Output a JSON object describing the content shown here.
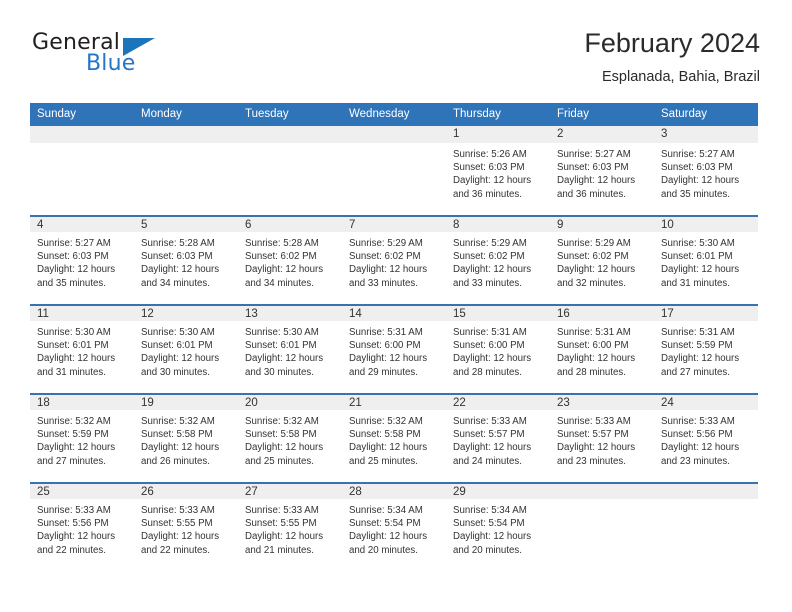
{
  "brand": {
    "name_part1": "General",
    "name_part2": "Blue",
    "logo_icon": "triangle-logo-icon"
  },
  "header": {
    "title": "February 2024",
    "location": "Esplanada, Bahia, Brazil"
  },
  "colors": {
    "header_blue": "#2f73b8",
    "week_divider_blue": "#3a72b0",
    "daynum_band_gray": "#efefef",
    "brand_blue": "#2277c8",
    "text": "#333333"
  },
  "calendar": {
    "weekday_headers": [
      "Sunday",
      "Monday",
      "Tuesday",
      "Wednesday",
      "Thursday",
      "Friday",
      "Saturday"
    ],
    "weeks": [
      [
        {
          "day": "",
          "lines": []
        },
        {
          "day": "",
          "lines": []
        },
        {
          "day": "",
          "lines": []
        },
        {
          "day": "",
          "lines": []
        },
        {
          "day": "1",
          "lines": [
            "Sunrise: 5:26 AM",
            "Sunset: 6:03 PM",
            "Daylight: 12 hours",
            "and 36 minutes."
          ]
        },
        {
          "day": "2",
          "lines": [
            "Sunrise: 5:27 AM",
            "Sunset: 6:03 PM",
            "Daylight: 12 hours",
            "and 36 minutes."
          ]
        },
        {
          "day": "3",
          "lines": [
            "Sunrise: 5:27 AM",
            "Sunset: 6:03 PM",
            "Daylight: 12 hours",
            "and 35 minutes."
          ]
        }
      ],
      [
        {
          "day": "4",
          "lines": [
            "Sunrise: 5:27 AM",
            "Sunset: 6:03 PM",
            "Daylight: 12 hours",
            "and 35 minutes."
          ]
        },
        {
          "day": "5",
          "lines": [
            "Sunrise: 5:28 AM",
            "Sunset: 6:03 PM",
            "Daylight: 12 hours",
            "and 34 minutes."
          ]
        },
        {
          "day": "6",
          "lines": [
            "Sunrise: 5:28 AM",
            "Sunset: 6:02 PM",
            "Daylight: 12 hours",
            "and 34 minutes."
          ]
        },
        {
          "day": "7",
          "lines": [
            "Sunrise: 5:29 AM",
            "Sunset: 6:02 PM",
            "Daylight: 12 hours",
            "and 33 minutes."
          ]
        },
        {
          "day": "8",
          "lines": [
            "Sunrise: 5:29 AM",
            "Sunset: 6:02 PM",
            "Daylight: 12 hours",
            "and 33 minutes."
          ]
        },
        {
          "day": "9",
          "lines": [
            "Sunrise: 5:29 AM",
            "Sunset: 6:02 PM",
            "Daylight: 12 hours",
            "and 32 minutes."
          ]
        },
        {
          "day": "10",
          "lines": [
            "Sunrise: 5:30 AM",
            "Sunset: 6:01 PM",
            "Daylight: 12 hours",
            "and 31 minutes."
          ]
        }
      ],
      [
        {
          "day": "11",
          "lines": [
            "Sunrise: 5:30 AM",
            "Sunset: 6:01 PM",
            "Daylight: 12 hours",
            "and 31 minutes."
          ]
        },
        {
          "day": "12",
          "lines": [
            "Sunrise: 5:30 AM",
            "Sunset: 6:01 PM",
            "Daylight: 12 hours",
            "and 30 minutes."
          ]
        },
        {
          "day": "13",
          "lines": [
            "Sunrise: 5:30 AM",
            "Sunset: 6:01 PM",
            "Daylight: 12 hours",
            "and 30 minutes."
          ]
        },
        {
          "day": "14",
          "lines": [
            "Sunrise: 5:31 AM",
            "Sunset: 6:00 PM",
            "Daylight: 12 hours",
            "and 29 minutes."
          ]
        },
        {
          "day": "15",
          "lines": [
            "Sunrise: 5:31 AM",
            "Sunset: 6:00 PM",
            "Daylight: 12 hours",
            "and 28 minutes."
          ]
        },
        {
          "day": "16",
          "lines": [
            "Sunrise: 5:31 AM",
            "Sunset: 6:00 PM",
            "Daylight: 12 hours",
            "and 28 minutes."
          ]
        },
        {
          "day": "17",
          "lines": [
            "Sunrise: 5:31 AM",
            "Sunset: 5:59 PM",
            "Daylight: 12 hours",
            "and 27 minutes."
          ]
        }
      ],
      [
        {
          "day": "18",
          "lines": [
            "Sunrise: 5:32 AM",
            "Sunset: 5:59 PM",
            "Daylight: 12 hours",
            "and 27 minutes."
          ]
        },
        {
          "day": "19",
          "lines": [
            "Sunrise: 5:32 AM",
            "Sunset: 5:58 PM",
            "Daylight: 12 hours",
            "and 26 minutes."
          ]
        },
        {
          "day": "20",
          "lines": [
            "Sunrise: 5:32 AM",
            "Sunset: 5:58 PM",
            "Daylight: 12 hours",
            "and 25 minutes."
          ]
        },
        {
          "day": "21",
          "lines": [
            "Sunrise: 5:32 AM",
            "Sunset: 5:58 PM",
            "Daylight: 12 hours",
            "and 25 minutes."
          ]
        },
        {
          "day": "22",
          "lines": [
            "Sunrise: 5:33 AM",
            "Sunset: 5:57 PM",
            "Daylight: 12 hours",
            "and 24 minutes."
          ]
        },
        {
          "day": "23",
          "lines": [
            "Sunrise: 5:33 AM",
            "Sunset: 5:57 PM",
            "Daylight: 12 hours",
            "and 23 minutes."
          ]
        },
        {
          "day": "24",
          "lines": [
            "Sunrise: 5:33 AM",
            "Sunset: 5:56 PM",
            "Daylight: 12 hours",
            "and 23 minutes."
          ]
        }
      ],
      [
        {
          "day": "25",
          "lines": [
            "Sunrise: 5:33 AM",
            "Sunset: 5:56 PM",
            "Daylight: 12 hours",
            "and 22 minutes."
          ]
        },
        {
          "day": "26",
          "lines": [
            "Sunrise: 5:33 AM",
            "Sunset: 5:55 PM",
            "Daylight: 12 hours",
            "and 22 minutes."
          ]
        },
        {
          "day": "27",
          "lines": [
            "Sunrise: 5:33 AM",
            "Sunset: 5:55 PM",
            "Daylight: 12 hours",
            "and 21 minutes."
          ]
        },
        {
          "day": "28",
          "lines": [
            "Sunrise: 5:34 AM",
            "Sunset: 5:54 PM",
            "Daylight: 12 hours",
            "and 20 minutes."
          ]
        },
        {
          "day": "29",
          "lines": [
            "Sunrise: 5:34 AM",
            "Sunset: 5:54 PM",
            "Daylight: 12 hours",
            "and 20 minutes."
          ]
        },
        {
          "day": "",
          "lines": []
        },
        {
          "day": "",
          "lines": []
        }
      ]
    ]
  }
}
